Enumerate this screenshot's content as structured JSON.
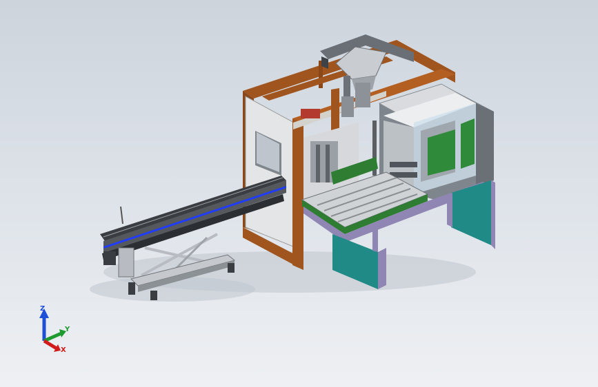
{
  "viewport": {
    "background_top": "#cdd4dc",
    "background_bottom": "#eef0f3"
  },
  "model": {
    "frame_color": "#a0541e",
    "panel_color": "#e4e5e6",
    "conveyor_color": "#2e7d32",
    "base_color": "#1f8a86",
    "tray_color": "#8f86b4",
    "belt_accent_color": "#1e3cff",
    "metal_color": "#b8bcc2"
  },
  "triad": {
    "z_label": "Z",
    "y_label": "Y",
    "x_label": "X",
    "z_color": "#1f4fd6",
    "y_color": "#1f9a2f",
    "x_color": "#d11a1a"
  }
}
